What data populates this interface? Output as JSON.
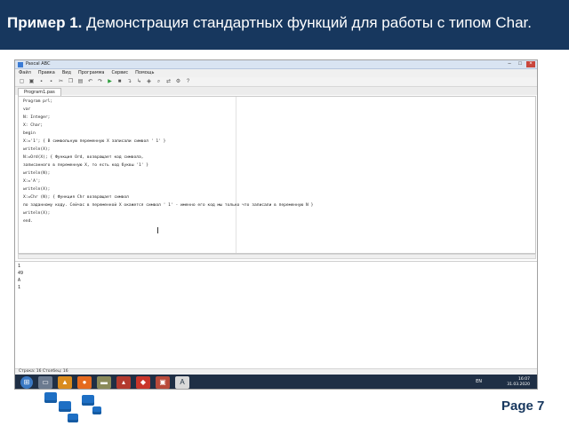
{
  "slide": {
    "title_bold": "Пример 1.",
    "title_rest": " Демонстрация стандартных функций для работы с типом Char.",
    "page_label": "Page 7"
  },
  "window": {
    "app_title": "Pascal ABC"
  },
  "menu": {
    "items": [
      "Файл",
      "Правка",
      "Вид",
      "Программа",
      "Сервис",
      "Помощь"
    ]
  },
  "tab": {
    "label": "Program1.pas"
  },
  "code": {
    "lines": [
      "Program prl;",
      "var",
      "N: Integer;",
      "X: Char;",
      "begin",
      "X:='1'; { В символьную переменную X записали символ ' 1' }",
      "writeln(X);",
      "N:=Ord(X); { Функция Ord, возвращает код символа,",
      "записанного в переменную X, то есть код буквы '1' }",
      "writeln(N);",
      "X:='A';",
      "writeln(X);",
      "X:=Chr (N); { Функция Chr возвращает символ",
      "по заданному коду. Сейчас в переменной X окажется символ ' 1' - именно его код мы только что записали в переменную N }",
      "writeln(X);",
      "end."
    ]
  },
  "output": {
    "lines": [
      "1",
      "49",
      "A",
      "1"
    ]
  },
  "status": {
    "text": "Строка: 16    Столбец: 16"
  },
  "taskbar": {
    "lang": "EN",
    "time": "16:07",
    "date": "31.03.2020"
  }
}
